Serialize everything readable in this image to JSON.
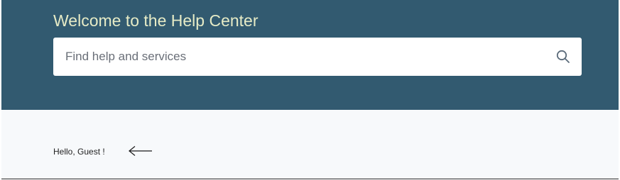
{
  "hero": {
    "title": "Welcome to the Help Center",
    "search": {
      "placeholder": "Find help and services",
      "value": "",
      "icon": "search-icon"
    },
    "background_color": "#325a70",
    "title_color": "#e6ebc6"
  },
  "greeting": {
    "text": "Hello, Guest !",
    "arrow_icon": "arrow-left-icon"
  }
}
